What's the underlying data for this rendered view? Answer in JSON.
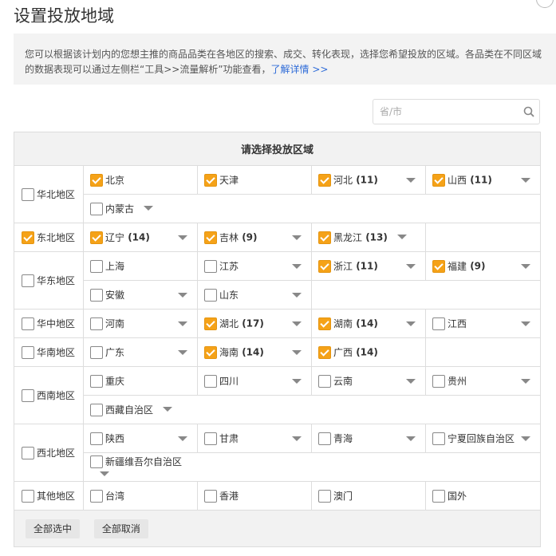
{
  "title": "设置投放地域",
  "notice": {
    "text": "您可以根据该计划内的您想主推的商品品类在各地区的搜索、成交、转化表现，选择您希望投放的区域。各品类在不同区域的数据表现可以通过左侧栏“工具>>流量解析”功能查看，",
    "link": "了解详情 >>"
  },
  "search": {
    "placeholder": "省/市"
  },
  "table_header": "请选择投放区域",
  "regions": [
    {
      "name": "华北地区",
      "checked": false,
      "rows": [
        [
          {
            "name": "北京",
            "count": "",
            "checked": true,
            "caret": false
          },
          {
            "name": "天津",
            "count": "",
            "checked": true,
            "caret": false
          },
          {
            "name": "河北",
            "count": " (11)",
            "checked": true,
            "caret": true
          },
          {
            "name": "山西",
            "count": " (11)",
            "checked": true,
            "caret": true
          }
        ],
        [
          {
            "name": "内蒙古",
            "count": "",
            "checked": false,
            "caret": true,
            "inline": true
          }
        ]
      ]
    },
    {
      "name": "东北地区",
      "checked": true,
      "rows": [
        [
          {
            "name": "辽宁",
            "count": " (14)",
            "checked": true,
            "caret": true
          },
          {
            "name": "吉林",
            "count": " (9)",
            "checked": true,
            "caret": true
          },
          {
            "name": "黑龙江",
            "count": " (13)",
            "checked": true,
            "caret": true,
            "inline": true
          }
        ]
      ]
    },
    {
      "name": "华东地区",
      "checked": false,
      "rows": [
        [
          {
            "name": "上海",
            "count": "",
            "checked": false,
            "caret": false
          },
          {
            "name": "江苏",
            "count": "",
            "checked": false,
            "caret": true
          },
          {
            "name": "浙江",
            "count": " (11)",
            "checked": true,
            "caret": true
          },
          {
            "name": "福建",
            "count": " (9)",
            "checked": true,
            "caret": true
          }
        ],
        [
          {
            "name": "安徽",
            "count": "",
            "checked": false,
            "caret": true
          },
          {
            "name": "山东",
            "count": "",
            "checked": false,
            "caret": true
          }
        ]
      ]
    },
    {
      "name": "华中地区",
      "checked": false,
      "rows": [
        [
          {
            "name": "河南",
            "count": "",
            "checked": false,
            "caret": true
          },
          {
            "name": "湖北",
            "count": " (17)",
            "checked": true,
            "caret": true
          },
          {
            "name": "湖南",
            "count": " (14)",
            "checked": true,
            "caret": true
          },
          {
            "name": "江西",
            "count": "",
            "checked": false,
            "caret": true
          }
        ]
      ]
    },
    {
      "name": "华南地区",
      "checked": false,
      "rows": [
        [
          {
            "name": "广东",
            "count": "",
            "checked": false,
            "caret": true
          },
          {
            "name": "海南",
            "count": " (14)",
            "checked": true,
            "caret": true
          },
          {
            "name": "广西",
            "count": " (14)",
            "checked": true,
            "caret": false
          }
        ]
      ]
    },
    {
      "name": "西南地区",
      "checked": false,
      "rows": [
        [
          {
            "name": "重庆",
            "count": "",
            "checked": false,
            "caret": false
          },
          {
            "name": "四川",
            "count": "",
            "checked": false,
            "caret": true
          },
          {
            "name": "云南",
            "count": "",
            "checked": false,
            "caret": true
          },
          {
            "name": "贵州",
            "count": "",
            "checked": false,
            "caret": true
          }
        ],
        [
          {
            "name": "西藏自治区",
            "count": "",
            "checked": false,
            "caret": true,
            "inline": true
          }
        ]
      ]
    },
    {
      "name": "西北地区",
      "checked": false,
      "rows": [
        [
          {
            "name": "陕西",
            "count": "",
            "checked": false,
            "caret": true
          },
          {
            "name": "甘肃",
            "count": "",
            "checked": false,
            "caret": true
          },
          {
            "name": "青海",
            "count": "",
            "checked": false,
            "caret": true
          },
          {
            "name": "宁夏回族自治区",
            "count": "",
            "checked": false,
            "caret": true
          }
        ],
        [
          {
            "name": "新疆维吾尔自治区",
            "count": "",
            "checked": false,
            "caret": true,
            "inline": true
          }
        ]
      ]
    },
    {
      "name": "其他地区",
      "checked": false,
      "rows": [
        [
          {
            "name": "台湾",
            "count": "",
            "checked": false,
            "caret": false
          },
          {
            "name": "香港",
            "count": "",
            "checked": false,
            "caret": false
          },
          {
            "name": "澳门",
            "count": "",
            "checked": false,
            "caret": false
          },
          {
            "name": "国外",
            "count": "",
            "checked": false,
            "caret": false
          }
        ]
      ]
    }
  ],
  "footer": {
    "select_all": "全部选中",
    "deselect_all": "全部取消"
  },
  "colors": {
    "checked": "#f5a218",
    "link": "#2f6cd8"
  }
}
